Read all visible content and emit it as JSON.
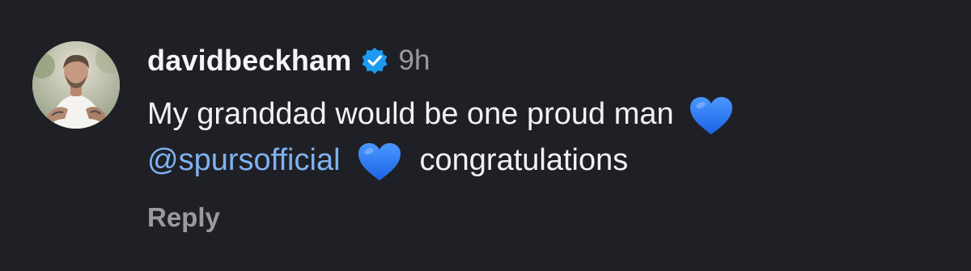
{
  "comment": {
    "username": "davidbeckham",
    "verified_icon": "verified-badge-icon",
    "timestamp": "9h",
    "text_line_1": "My granddad would be one proud man",
    "mention": "@spursofficial",
    "text_line_2_end": "congratulations",
    "heart_icon": "blue-heart-icon",
    "reply_label": "Reply"
  },
  "colors": {
    "background": "#1f2026",
    "text": "#f2f2f2",
    "muted": "#9a9ba0",
    "mention": "#7fb2f0",
    "verified": "#1d9bf0",
    "heart": "#2f7cf6"
  }
}
